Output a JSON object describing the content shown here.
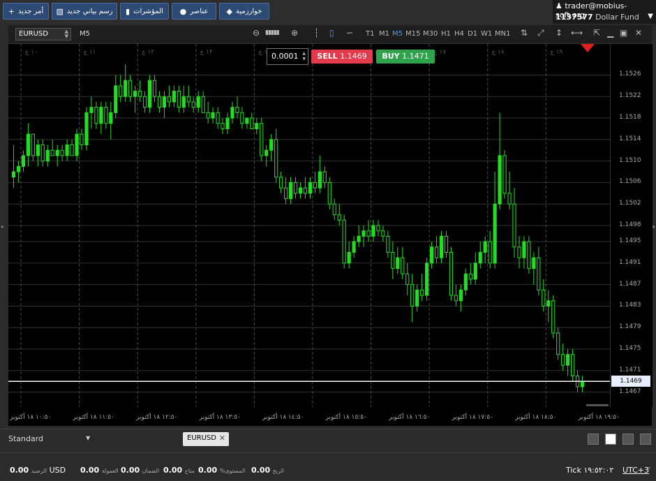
{
  "toolbar": {
    "buttons": [
      {
        "label": "أمر جديد",
        "icon": "plus-icon",
        "glyph": "+"
      },
      {
        "label": "رسم بياني جديد",
        "icon": "chart-icon",
        "glyph": "▨"
      },
      {
        "label": "المؤشرات",
        "icon": "indicators-icon",
        "glyph": "▮"
      },
      {
        "label": "عناصر",
        "icon": "objects-icon",
        "glyph": "●"
      },
      {
        "label": "خوارزمية",
        "icon": "algorithm-icon",
        "glyph": "◆"
      }
    ]
  },
  "account": {
    "user": "trader@mobius-soft.org",
    "number": "1137577",
    "name": "Dollar Fund",
    "user_icon": "user-icon",
    "caret": "▼"
  },
  "chart_toolbar": {
    "symbol": "EURUSD",
    "period": "M5",
    "zoom_out": "⊖",
    "zoom_in": "⊕",
    "timeframes": [
      "T1",
      "M1",
      "M5",
      "M15",
      "M30",
      "H1",
      "H4",
      "D1",
      "W1",
      "MN1"
    ],
    "active_timeframe": "M5",
    "tools": [
      "⇅",
      "⤢",
      "↕",
      "⟷"
    ],
    "window_controls": [
      "⇱",
      "▁",
      "▣",
      "✕"
    ]
  },
  "trade": {
    "lot": "0.0001",
    "sell_label": "SELL",
    "sell_price": "1.1469",
    "buy_label": "BUY",
    "buy_price": "1.1471"
  },
  "price_axis": {
    "labels": [
      "1.1526",
      "1.1522",
      "1.1518",
      "1.1514",
      "1.1510",
      "1.1506",
      "1.1502",
      "1.1498",
      "1.1495",
      "1.1491",
      "1.1487",
      "1.1483",
      "1.1479",
      "1.1475",
      "1.1471",
      "1.1467"
    ],
    "current": "1.1469"
  },
  "time_axis": {
    "labels": [
      "١٠:٥٠ ١٨ أكتوبر",
      "١١:٥٠ ١٨ أكتوبر",
      "١٢:٥٠ ١٨ أكتوبر",
      "١٣:٥٠ ١٨ أكتوبر",
      "١٤:٥٠ ١٨ أكتوبر",
      "١٥:٥٠ ١٨ أكتوبر",
      "١٦:٥٠ ١٨ أكتوبر",
      "١٧:٥٠ ١٨ أكتوبر",
      "١٨:٥٠ ١٨ أكتوبر",
      "١٩:٥٠ ١٨ أكتوبر"
    ],
    "hour_marks": [
      "١٠ ع",
      "١١ ع",
      "١٢ ع",
      "١٣ ع",
      "١٤ ع",
      "١٥ ع",
      "١٦ ع",
      "١٧ ع",
      "١٨ ع",
      "١٩ ع"
    ]
  },
  "chart_data": {
    "type": "candlestick",
    "symbol": "EURUSD",
    "timeframe": "M5",
    "ylim": [
      1.1465,
      1.1531
    ],
    "colors": {
      "up": "#22dd22",
      "down": "#0b0b0b",
      "wick": "#22dd22",
      "bid_line": "#ffffff",
      "grid": "#333333",
      "hour_grid": "#4a4a4a"
    },
    "candles": [
      [
        1.1507,
        1.1513,
        1.1505,
        1.1508
      ],
      [
        1.1508,
        1.151,
        1.1506,
        1.1509
      ],
      [
        1.1509,
        1.1512,
        1.1508,
        1.1511
      ],
      [
        1.1511,
        1.1517,
        1.1509,
        1.1515
      ],
      [
        1.1515,
        1.1515,
        1.151,
        1.1511
      ],
      [
        1.1511,
        1.1514,
        1.1509,
        1.1513
      ],
      [
        1.1513,
        1.1514,
        1.1509,
        1.151
      ],
      [
        1.151,
        1.1513,
        1.1509,
        1.1512
      ],
      [
        1.1512,
        1.1514,
        1.1511,
        1.1511
      ],
      [
        1.1511,
        1.1513,
        1.1509,
        1.1512
      ],
      [
        1.1512,
        1.1513,
        1.151,
        1.1511
      ],
      [
        1.1511,
        1.1514,
        1.151,
        1.1513
      ],
      [
        1.1513,
        1.1514,
        1.1511,
        1.1511
      ],
      [
        1.1511,
        1.1516,
        1.151,
        1.1515
      ],
      [
        1.1515,
        1.1516,
        1.1512,
        1.1513
      ],
      [
        1.1513,
        1.152,
        1.1512,
        1.1519
      ],
      [
        1.1519,
        1.1522,
        1.1516,
        1.152
      ],
      [
        1.152,
        1.1521,
        1.1516,
        1.1517
      ],
      [
        1.1517,
        1.1521,
        1.1515,
        1.152
      ],
      [
        1.152,
        1.1521,
        1.1516,
        1.1517
      ],
      [
        1.1517,
        1.1521,
        1.1514,
        1.1519
      ],
      [
        1.1519,
        1.1526,
        1.1518,
        1.1524
      ],
      [
        1.1524,
        1.1526,
        1.1521,
        1.1522
      ],
      [
        1.1522,
        1.1528,
        1.1521,
        1.1525
      ],
      [
        1.1525,
        1.1526,
        1.1521,
        1.1522
      ],
      [
        1.1522,
        1.1524,
        1.1519,
        1.1523
      ],
      [
        1.1523,
        1.1525,
        1.1521,
        1.1522
      ],
      [
        1.1522,
        1.1523,
        1.1519,
        1.152
      ],
      [
        1.152,
        1.1526,
        1.1519,
        1.1525
      ],
      [
        1.1525,
        1.1526,
        1.1521,
        1.1522
      ],
      [
        1.1522,
        1.1523,
        1.1519,
        1.152
      ],
      [
        1.152,
        1.1523,
        1.1518,
        1.1522
      ],
      [
        1.1522,
        1.1524,
        1.152,
        1.1521
      ],
      [
        1.1521,
        1.1524,
        1.152,
        1.1523
      ],
      [
        1.1523,
        1.1524,
        1.1519,
        1.152
      ],
      [
        1.152,
        1.1524,
        1.1519,
        1.1522
      ],
      [
        1.1522,
        1.1524,
        1.152,
        1.1521
      ],
      [
        1.1521,
        1.1522,
        1.1519,
        1.152
      ],
      [
        1.152,
        1.1523,
        1.1519,
        1.1522
      ],
      [
        1.1522,
        1.1523,
        1.1519,
        1.1519
      ],
      [
        1.1519,
        1.1521,
        1.1517,
        1.1518
      ],
      [
        1.1518,
        1.152,
        1.1517,
        1.1519
      ],
      [
        1.1519,
        1.152,
        1.1516,
        1.1517
      ],
      [
        1.1517,
        1.1518,
        1.1515,
        1.1516
      ],
      [
        1.1516,
        1.1519,
        1.1515,
        1.1518
      ],
      [
        1.1518,
        1.1521,
        1.1517,
        1.152
      ],
      [
        1.152,
        1.1522,
        1.1518,
        1.1519
      ],
      [
        1.1519,
        1.152,
        1.1516,
        1.1517
      ],
      [
        1.1517,
        1.1518,
        1.1516,
        1.1518
      ],
      [
        1.1518,
        1.1519,
        1.1516,
        1.1516
      ],
      [
        1.1516,
        1.1518,
        1.1515,
        1.1517
      ],
      [
        1.1517,
        1.1518,
        1.151,
        1.1511
      ],
      [
        1.1511,
        1.1513,
        1.1509,
        1.1512
      ],
      [
        1.1512,
        1.1515,
        1.151,
        1.1514
      ],
      [
        1.1514,
        1.1516,
        1.1506,
        1.1507
      ],
      [
        1.1507,
        1.1508,
        1.1504,
        1.1505
      ],
      [
        1.1505,
        1.1507,
        1.1502,
        1.1503
      ],
      [
        1.1503,
        1.1507,
        1.1502,
        1.1506
      ],
      [
        1.1506,
        1.1507,
        1.1503,
        1.1504
      ],
      [
        1.1504,
        1.1506,
        1.1503,
        1.1505
      ],
      [
        1.1505,
        1.1507,
        1.1503,
        1.1504
      ],
      [
        1.1504,
        1.1507,
        1.1503,
        1.1506
      ],
      [
        1.1506,
        1.1508,
        1.1504,
        1.1505
      ],
      [
        1.1505,
        1.1511,
        1.1504,
        1.1508
      ],
      [
        1.1508,
        1.1509,
        1.1505,
        1.1506
      ],
      [
        1.1506,
        1.1507,
        1.1501,
        1.1502
      ],
      [
        1.1502,
        1.1503,
        1.1499,
        1.15
      ],
      [
        1.15,
        1.1502,
        1.1498,
        1.1499
      ],
      [
        1.1499,
        1.15,
        1.149,
        1.1491
      ],
      [
        1.1491,
        1.1495,
        1.149,
        1.1493
      ],
      [
        1.1493,
        1.1496,
        1.1492,
        1.1495
      ],
      [
        1.1495,
        1.1498,
        1.1494,
        1.1496
      ],
      [
        1.1496,
        1.1498,
        1.1494,
        1.1497
      ],
      [
        1.1497,
        1.1499,
        1.1495,
        1.1496
      ],
      [
        1.1496,
        1.1499,
        1.1495,
        1.1498
      ],
      [
        1.1498,
        1.1499,
        1.1496,
        1.1497
      ],
      [
        1.1497,
        1.1498,
        1.1495,
        1.1496
      ],
      [
        1.1496,
        1.1497,
        1.1492,
        1.1493
      ],
      [
        1.1493,
        1.1495,
        1.1488,
        1.149
      ],
      [
        1.149,
        1.1494,
        1.1489,
        1.1492
      ],
      [
        1.1492,
        1.1494,
        1.1488,
        1.1489
      ],
      [
        1.1489,
        1.1491,
        1.1485,
        1.1487
      ],
      [
        1.1487,
        1.1489,
        1.148,
        1.1483
      ],
      [
        1.1483,
        1.1487,
        1.1482,
        1.1486
      ],
      [
        1.1486,
        1.1489,
        1.1484,
        1.1485
      ],
      [
        1.1485,
        1.1492,
        1.1484,
        1.1491
      ],
      [
        1.1491,
        1.1495,
        1.149,
        1.1494
      ],
      [
        1.1494,
        1.1496,
        1.1491,
        1.1492
      ],
      [
        1.1492,
        1.1497,
        1.1491,
        1.1496
      ],
      [
        1.1496,
        1.1497,
        1.1492,
        1.1493
      ],
      [
        1.1493,
        1.1494,
        1.1484,
        1.1485
      ],
      [
        1.1485,
        1.1487,
        1.1483,
        1.1484
      ],
      [
        1.1484,
        1.1487,
        1.1482,
        1.1486
      ],
      [
        1.1486,
        1.149,
        1.1485,
        1.1489
      ],
      [
        1.1489,
        1.1491,
        1.1487,
        1.1488
      ],
      [
        1.1488,
        1.1493,
        1.1487,
        1.1491
      ],
      [
        1.1491,
        1.1495,
        1.149,
        1.1493
      ],
      [
        1.1493,
        1.1496,
        1.1491,
        1.1495
      ],
      [
        1.1495,
        1.1497,
        1.149,
        1.1491
      ],
      [
        1.1491,
        1.1508,
        1.149,
        1.1502
      ],
      [
        1.1502,
        1.1519,
        1.1501,
        1.1511
      ],
      [
        1.1511,
        1.1512,
        1.1503,
        1.1504
      ],
      [
        1.1504,
        1.1508,
        1.1501,
        1.1502
      ],
      [
        1.1502,
        1.1505,
        1.1492,
        1.1494
      ],
      [
        1.1494,
        1.1496,
        1.149,
        1.1492
      ],
      [
        1.1492,
        1.1496,
        1.149,
        1.1495
      ],
      [
        1.1495,
        1.1496,
        1.1489,
        1.149
      ],
      [
        1.149,
        1.1493,
        1.1487,
        1.1492
      ],
      [
        1.1492,
        1.1494,
        1.1485,
        1.1486
      ],
      [
        1.1486,
        1.1488,
        1.1482,
        1.1483
      ],
      [
        1.1483,
        1.1486,
        1.148,
        1.1484
      ],
      [
        1.1484,
        1.1485,
        1.1477,
        1.1478
      ],
      [
        1.1478,
        1.1479,
        1.1473,
        1.1474
      ],
      [
        1.1474,
        1.1476,
        1.1471,
        1.1472
      ],
      [
        1.1472,
        1.1475,
        1.147,
        1.1474
      ],
      [
        1.1474,
        1.1475,
        1.1469,
        1.147
      ],
      [
        1.147,
        1.1471,
        1.1467,
        1.1468
      ],
      [
        1.1468,
        1.147,
        1.1467,
        1.1469
      ]
    ]
  },
  "bottom_tabs": {
    "workspace": "Standard",
    "caret": "▼",
    "symbol_tab": "EURUSD",
    "close": "✕",
    "layout_icons": [
      "layout-single-icon",
      "layout-grid-icon",
      "layout-columns-icon",
      "layout-rows-icon"
    ]
  },
  "status": {
    "balance_value": "0.00",
    "balance_label": "الرصيد",
    "currency": "USD",
    "commission_value": "0.00",
    "commission_label": "العمولة",
    "credit_value": "0.00",
    "credit_label": "الضمان",
    "available_value": "0.00",
    "available_label": "متاح",
    "level_value": "0.00",
    "level_label": "%المستوى",
    "profit_value": "0.00",
    "profit_label": "الربح",
    "tick_label": "Tick",
    "tick_time": "١٩:٥٢:٠٢",
    "timezone": "UTC+3",
    "tz_caret": "▽"
  }
}
